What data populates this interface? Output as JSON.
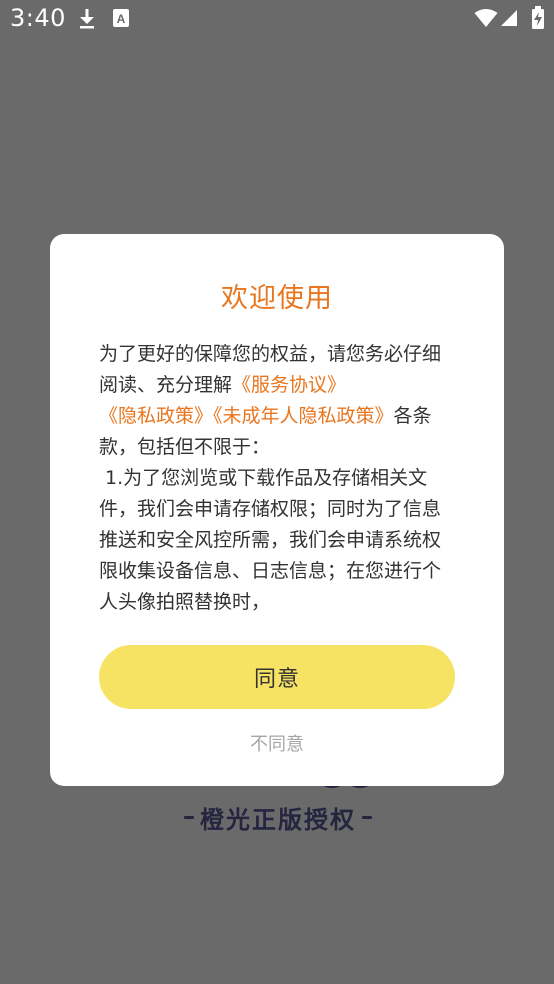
{
  "status_bar": {
    "time": "3:40",
    "icons": [
      "download-icon",
      "font-icon",
      "wifi-icon",
      "signal-icon",
      "battery-icon"
    ]
  },
  "background": {
    "brand_text": "橙光正版授权"
  },
  "dialog": {
    "title": "欢迎使用",
    "body": {
      "intro": "为了更好的保障您的权益，请您务必仔细阅读、充分理解",
      "link_service": "《服务协议》",
      "link_privacy": "《隐私政策》",
      "link_minor": "《未成年人隐私政策》",
      "after_links": "各条款，包括但不限于：\n 1.为了您浏览或下载作品及存储相关文件，我们会申请存储权限；同时为了信息推送和安全风控所需，我们会申请系统权限收集设备信息、日志信息；在您进行个人头像拍照替换时，"
    },
    "agree_label": "同意",
    "disagree_label": "不同意"
  },
  "colors": {
    "overlay": "#6a6a6a",
    "accent": "#e9761f",
    "agree_button": "#f7e363",
    "brand_text": "#262540"
  }
}
